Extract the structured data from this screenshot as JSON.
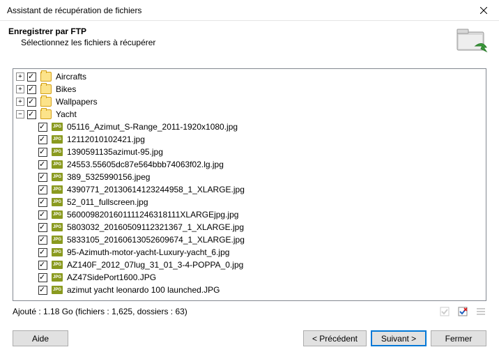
{
  "window": {
    "title": "Assistant de récupération de fichiers"
  },
  "header": {
    "title": "Enregistrer par FTP",
    "subtitle": "Sélectionnez les fichiers à récupérer"
  },
  "tree": {
    "folders": [
      {
        "name": "Aircrafts",
        "expanded": false,
        "checked": true
      },
      {
        "name": "Bikes",
        "expanded": false,
        "checked": true
      },
      {
        "name": "Wallpapers",
        "expanded": false,
        "checked": true
      },
      {
        "name": "Yacht",
        "expanded": true,
        "checked": true
      }
    ],
    "yacht_files": [
      "05116_Azimut_S-Range_2011-1920x1080.jpg",
      "12112010102421.jpg",
      "1390591135azimut-95.jpg",
      "24553.55605dc87e564bbb74063f02.lg.jpg",
      "389_5325990156.jpeg",
      "4390771_20130614123244958_1_XLARGE.jpg",
      "52_011_fullscreen.jpg",
      "5600098201601111246318111XLARGEjpg.jpg",
      "5803032_20160509112321367_1_XLARGE.jpg",
      "5833105_20160613052609674_1_XLARGE.jpg",
      "95-Azimuth-motor-yacht-Luxury-yacht_6.jpg",
      "AZ140F_2012_07lug_31_01_3-4-POPPA_0.jpg",
      "AZ47SidePort1600.JPG",
      "azimut yacht leonardo 100 launched.JPG"
    ]
  },
  "status": {
    "text": "Ajouté : 1.18 Go (fichiers : 1,625, dossiers : 63)"
  },
  "buttons": {
    "help": "Aide",
    "prev": "< Précédent",
    "next": "Suivant >",
    "close": "Fermer"
  }
}
